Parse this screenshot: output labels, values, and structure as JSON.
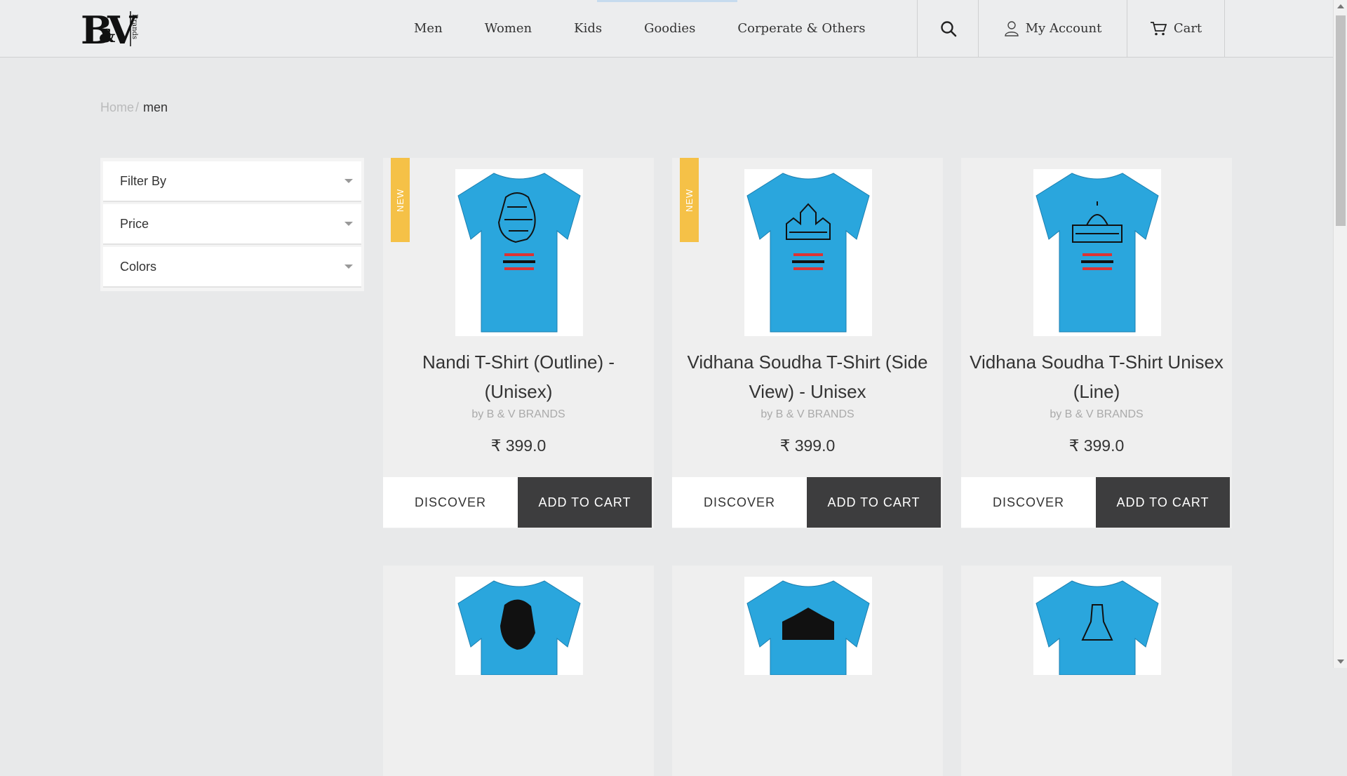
{
  "brand": {
    "logo_main": "B&V",
    "logo_side": "Brands"
  },
  "nav": {
    "items": [
      "Men",
      "Women",
      "Kids",
      "Goodies",
      "Corperate & Others"
    ]
  },
  "header": {
    "account_label": "My Account",
    "cart_label": "Cart"
  },
  "breadcrumb": {
    "home": "Home",
    "separator": "/",
    "current": "men"
  },
  "filters": {
    "items": [
      "Filter By",
      "Price",
      "Colors"
    ]
  },
  "colors": {
    "accent_badge": "#f5c147",
    "shirt_blue": "#2aa6dd",
    "button_dark": "#3d3d3e"
  },
  "products": [
    {
      "badge": "NEW",
      "title_line1": "Nandi T-Shirt (Outline) -",
      "title_line2": "(Unisex)",
      "by": "by B & V BRANDS",
      "price": "₹ 399.0",
      "discover": "DISCOVER",
      "add_to_cart": "ADD TO CART"
    },
    {
      "badge": "NEW",
      "title_line1": "Vidhana Soudha T-Shirt (Side",
      "title_line2": "View) - Unisex",
      "by": "by B & V BRANDS",
      "price": "₹ 399.0",
      "discover": "DISCOVER",
      "add_to_cart": "ADD TO CART"
    },
    {
      "badge": "",
      "title_line1": "Vidhana Soudha T-Shirt Unisex",
      "title_line2": "(Line)",
      "by": "by B & V BRANDS",
      "price": "₹ 399.0",
      "discover": "DISCOVER",
      "add_to_cart": "ADD TO CART"
    }
  ]
}
